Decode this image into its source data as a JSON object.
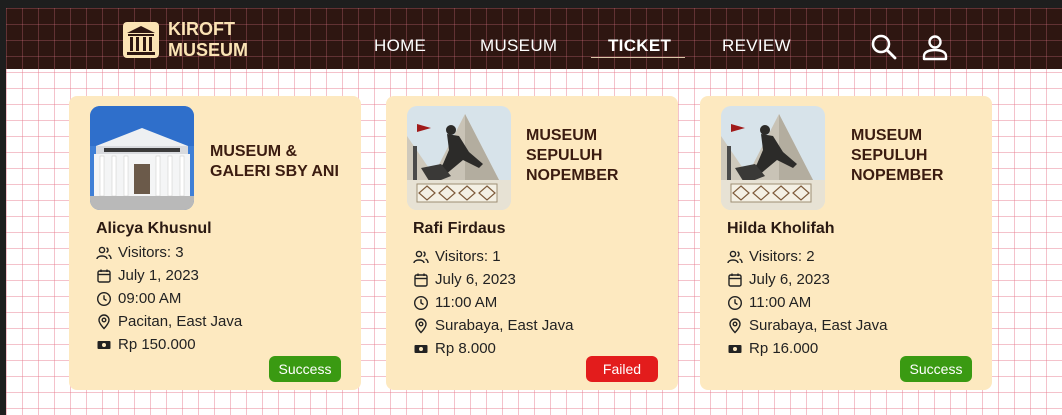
{
  "brand": {
    "line1": "KIROFT",
    "line2": "MUSEUM",
    "logo_icon": "museum-building-icon"
  },
  "nav": {
    "home": "HOME",
    "museum": "MUSEUM",
    "ticket": "TICKET",
    "review": "REVIEW",
    "active": "TICKET",
    "icons": [
      "search-icon",
      "user-icon"
    ]
  },
  "colors": {
    "nav_bg": "#2e1611",
    "card_bg": "#fde9c0",
    "success": "#3a9a12",
    "failed": "#e31c1c",
    "title": "#3b1c10"
  },
  "tickets": [
    {
      "museum": "MUSEUM & GALERI SBY ANI",
      "museum_lines": [
        "MUSEUM &",
        "GALERI SBY ANI"
      ],
      "name": "Alicya Khusnul",
      "visitors": "Visitors: 3",
      "date": "July 1, 2023",
      "time": "09:00 AM",
      "location": "Pacitan, East Java",
      "price": "Rp 150.000",
      "status": "Success"
    },
    {
      "museum": "MUSEUM SEPULUH NOPEMBER",
      "museum_lines": [
        "MUSEUM",
        "SEPULUH",
        "NOPEMBER"
      ],
      "name": "Rafi Firdaus",
      "visitors": "Visitors: 1",
      "date": "July 6, 2023",
      "time": "11:00 AM",
      "location": "Surabaya, East Java",
      "price": "Rp 8.000",
      "status": "Failed"
    },
    {
      "museum": "MUSEUM SEPULUH NOPEMBER",
      "museum_lines": [
        "MUSEUM",
        "SEPULUH",
        "NOPEMBER"
      ],
      "name": "Hilda Kholifah",
      "visitors": "Visitors: 2",
      "date": "July 6, 2023",
      "time": "11:00 AM",
      "location": "Surabaya, East Java",
      "price": "Rp 16.000",
      "status": "Success"
    }
  ]
}
